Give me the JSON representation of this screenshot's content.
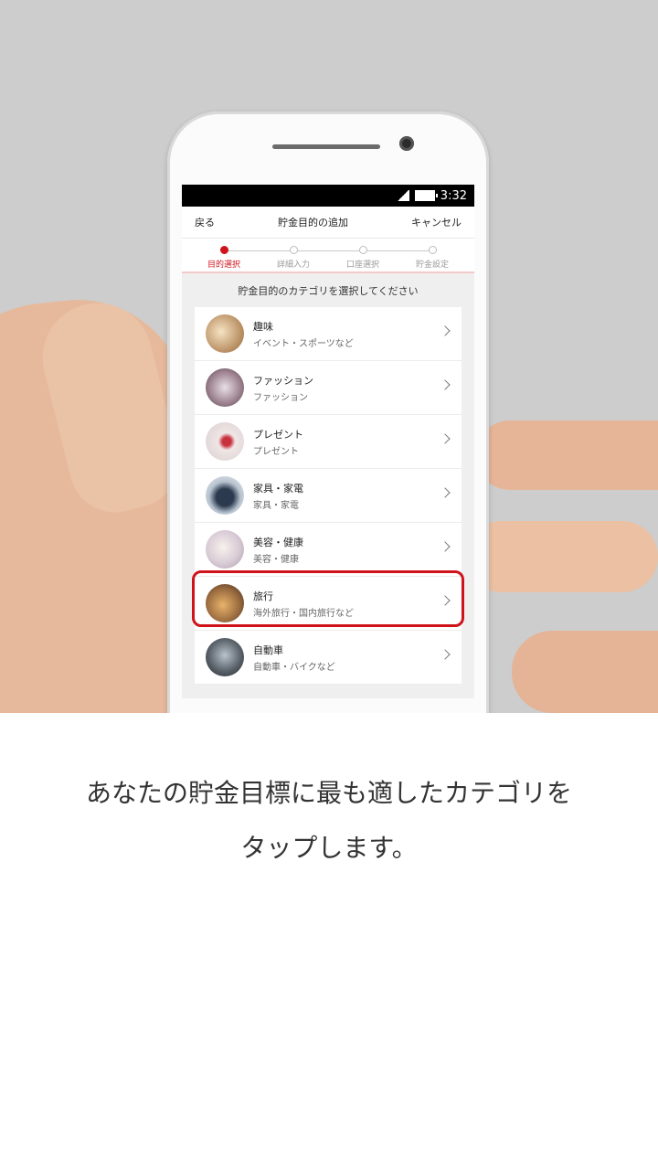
{
  "statusbar": {
    "time": "3:32"
  },
  "navbar": {
    "back": "戻る",
    "title": "貯金目的の追加",
    "cancel": "キャンセル"
  },
  "steps": [
    {
      "label": "目的選択",
      "active": true
    },
    {
      "label": "詳細入力",
      "active": false
    },
    {
      "label": "口座選択",
      "active": false
    },
    {
      "label": "貯金設定",
      "active": false
    }
  ],
  "prompt": "貯金目的のカテゴリを選択してください",
  "categories": [
    {
      "title": "趣味",
      "subtitle": "イベント・スポーツなど",
      "icon": "hobby-photo"
    },
    {
      "title": "ファッション",
      "subtitle": "ファッション",
      "icon": "fashion-photo"
    },
    {
      "title": "プレゼント",
      "subtitle": "プレゼント",
      "icon": "present-photo"
    },
    {
      "title": "家具・家電",
      "subtitle": "家具・家電",
      "icon": "furniture-photo"
    },
    {
      "title": "美容・健康",
      "subtitle": "美容・健康",
      "icon": "beauty-photo"
    },
    {
      "title": "旅行",
      "subtitle": "海外旅行・国内旅行など",
      "icon": "travel-photo",
      "highlighted": true
    },
    {
      "title": "自動車",
      "subtitle": "自動車・バイクなど",
      "icon": "car-photo"
    }
  ],
  "caption": {
    "line1": "あなたの貯金目標に最も適したカテゴリを",
    "line2": "タップします。"
  },
  "colors": {
    "accent": "#d0121b",
    "background": "#cdcdcd"
  }
}
